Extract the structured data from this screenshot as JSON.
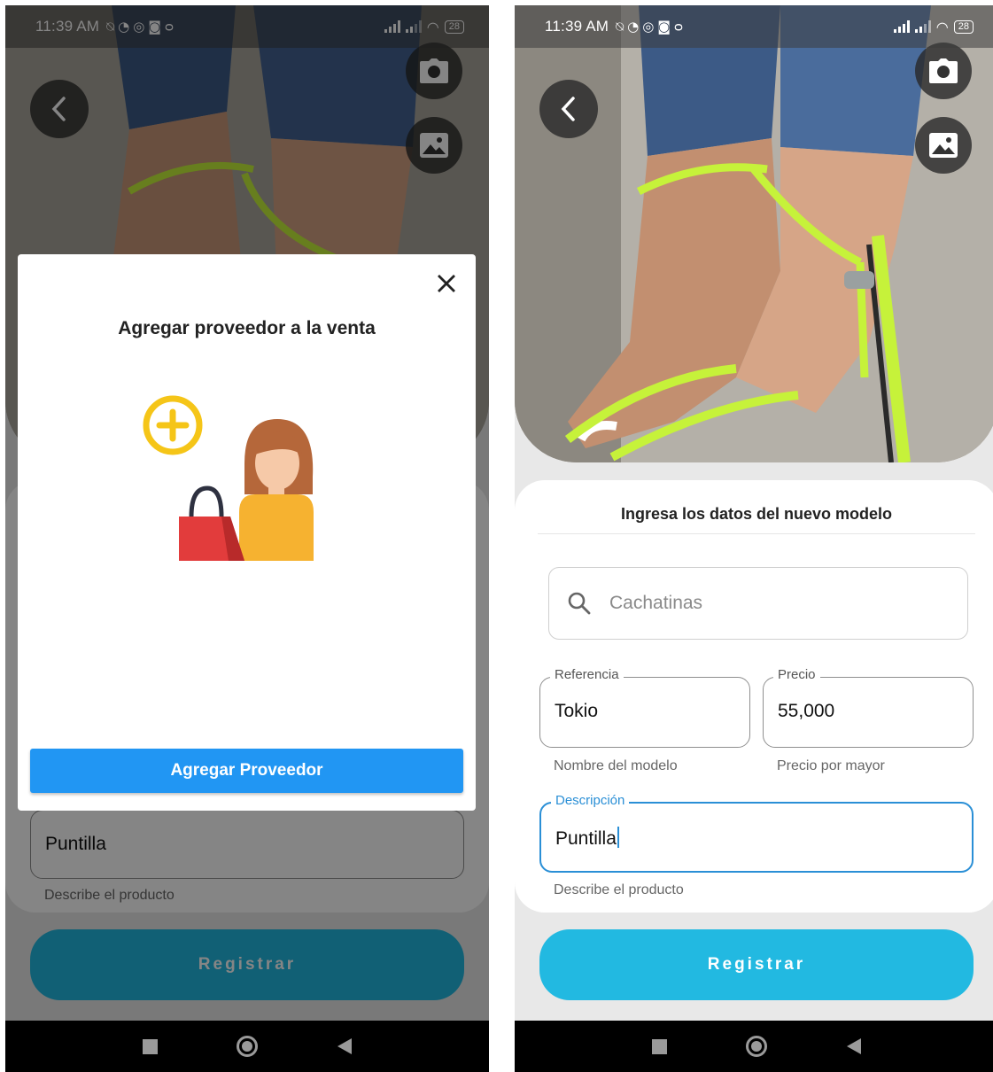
{
  "status_bar": {
    "time": "11:39 AM",
    "left_icons": [
      "bell-off-icon",
      "alarm-icon",
      "whatsapp-icon",
      "instagram-icon",
      "voicemail-icon"
    ],
    "battery": "28"
  },
  "hero": {
    "back_icon": "chevron-left-icon",
    "camera_icon": "camera-icon",
    "gallery_icon": "image-icon"
  },
  "form": {
    "title": "Ingresa los datos del nuevo modelo",
    "search_placeholder": "Cachatinas",
    "referencia": {
      "label": "Referencia",
      "value": "Tokio",
      "helper": "Nombre del modelo"
    },
    "precio": {
      "label": "Precio",
      "value": "55,000",
      "helper": "Precio por mayor"
    },
    "descripcion": {
      "label": "Descripción",
      "value": "Puntilla",
      "helper": "Describe el producto"
    }
  },
  "register_button": "Registrar",
  "dialog": {
    "title": "Agregar proveedor a la venta",
    "button": "Agregar Proveedor"
  },
  "colors": {
    "accent": "#22b9e1",
    "dialog_button": "#2196f3",
    "focus": "#2a8fd6",
    "strap": "#c6f23a"
  }
}
